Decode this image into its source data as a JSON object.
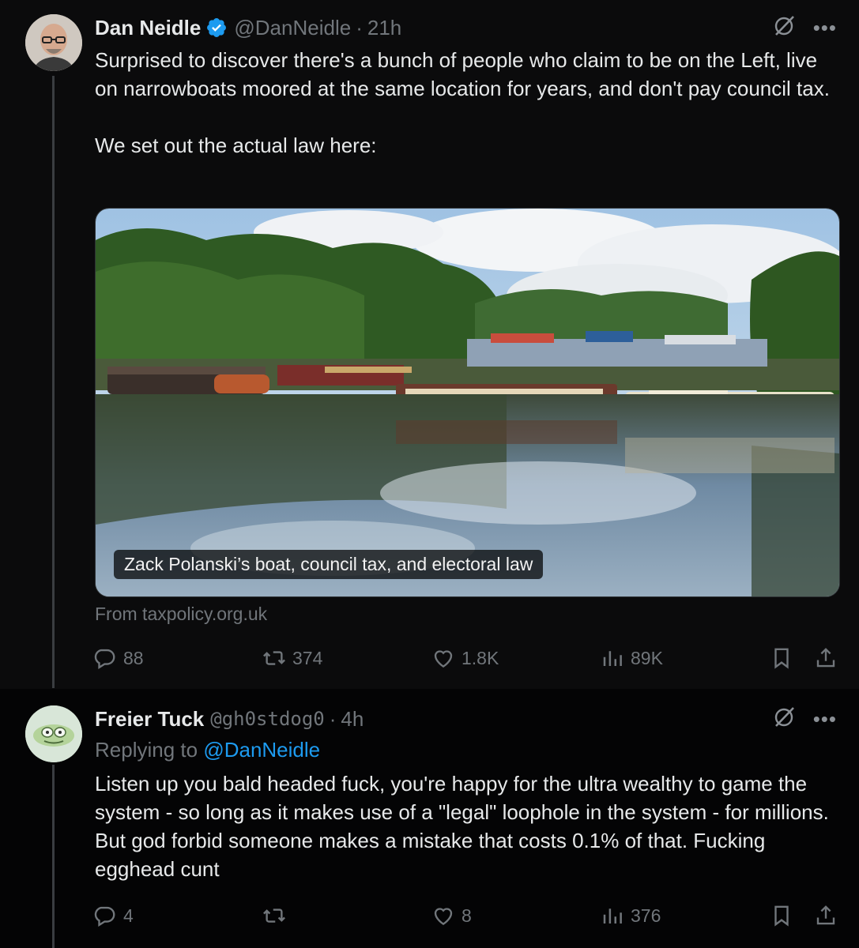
{
  "tweet": {
    "author_name": "Dan Neidle",
    "author_handle": "@DanNeidle",
    "time": "21h",
    "text": "Surprised to discover there's a bunch of people who claim to be on the Left, live on narrowboats moored at the same location for years, and don't pay council tax.\n\nWe set out the actual law here:",
    "card": {
      "caption": "Zack Polanski’s boat, council tax, and electoral law",
      "source": "From taxpolicy.org.uk"
    },
    "stats": {
      "replies": "88",
      "reposts": "374",
      "likes": "1.8K",
      "views": "89K"
    }
  },
  "reply": {
    "author_name": "Freier Tuck",
    "author_handle": "@gh0stdog0",
    "time": "4h",
    "replying_prefix": "Replying to ",
    "replying_handle": "@DanNeidle",
    "text": "Listen up you bald headed fuck, you're happy for the ultra wealthy to game the system - so long as it makes use of a \"legal\" loophole in the system - for millions. But god forbid someone makes a mistake that costs 0.1% of that. Fucking egghead cunt",
    "stats": {
      "replies": "4",
      "reposts": "",
      "likes": "8",
      "views": "376"
    }
  },
  "ui": {
    "separator": "·",
    "more": "•••"
  },
  "colors": {
    "background": "#000000",
    "text": "#e7e9ea",
    "muted": "#71767b",
    "accent": "#1d9bf0"
  },
  "icons": [
    "grok-icon",
    "more-icon",
    "verified-badge-icon",
    "reply-icon",
    "repost-icon",
    "like-icon",
    "views-icon",
    "bookmark-icon",
    "share-icon"
  ]
}
